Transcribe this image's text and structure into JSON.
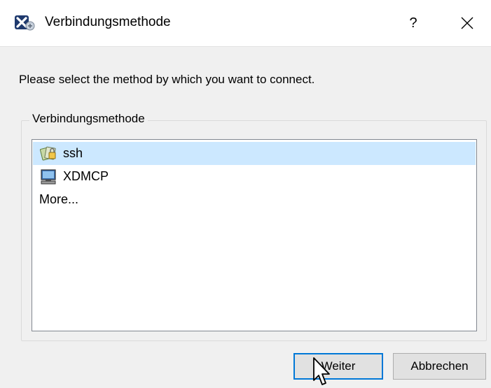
{
  "window": {
    "title": "Verbindungsmethode",
    "help_label": "?",
    "app_icon": "x2go-app-icon",
    "close_icon": "close-icon"
  },
  "prompt": "Please select the method by which you want to connect.",
  "group": {
    "title": "Verbindungsmethode",
    "items": [
      {
        "label": "ssh",
        "icon": "ssh-keys-icon",
        "selected": true
      },
      {
        "label": "XDMCP",
        "icon": "computer-monitor-icon",
        "selected": false
      },
      {
        "label": "More...",
        "icon": "",
        "selected": false
      }
    ]
  },
  "buttons": {
    "next_label": "Weiter",
    "cancel_label": "Abbrechen"
  },
  "colors": {
    "selection": "#cce8ff",
    "default_button_border": "#0078d7",
    "dialog_background": "#f0f0f0"
  }
}
